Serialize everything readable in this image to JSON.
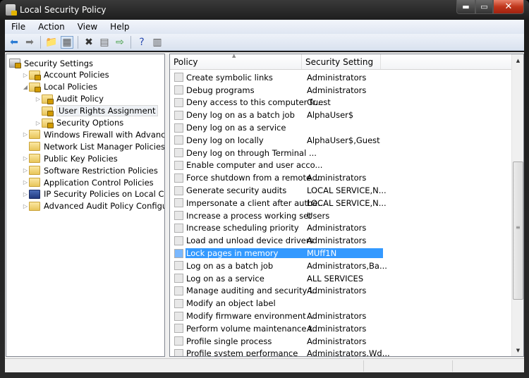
{
  "window": {
    "title": "Local Security Policy",
    "controls": [
      "minimize",
      "maximize",
      "close"
    ]
  },
  "menu": [
    "File",
    "Action",
    "View",
    "Help"
  ],
  "toolbar": [
    {
      "icon": "back-arrow-icon",
      "glyph": "⬅",
      "color": "#2a7bd4"
    },
    {
      "icon": "forward-arrow-icon",
      "glyph": "➡",
      "color": "#7a7a7a"
    },
    {
      "icon": "up-folder-icon",
      "glyph": "📁",
      "color": "#d8a520"
    },
    {
      "icon": "show-hide-tree-icon",
      "glyph": "▦",
      "color": "#555"
    },
    {
      "icon": "delete-icon",
      "glyph": "✖",
      "color": "#333"
    },
    {
      "icon": "properties-icon",
      "glyph": "▤",
      "color": "#666"
    },
    {
      "icon": "export-list-icon",
      "glyph": "⇨",
      "color": "#3a9a3a"
    },
    {
      "icon": "help-icon",
      "glyph": "?",
      "color": "#2a4ab0"
    },
    {
      "icon": "action-pane-icon",
      "glyph": "▥",
      "color": "#555"
    }
  ],
  "tree": [
    {
      "label": "Security Settings",
      "level": 0,
      "expander": "",
      "icon": "security-settings-icon"
    },
    {
      "label": "Account Policies",
      "level": 1,
      "expander": "▷",
      "icon": "lock-folder-icon"
    },
    {
      "label": "Local Policies",
      "level": 1,
      "expander": "◢",
      "icon": "lock-folder-icon"
    },
    {
      "label": "Audit Policy",
      "level": 2,
      "expander": "▷",
      "icon": "lock-folder-icon"
    },
    {
      "label": "User Rights Assignment",
      "level": 2,
      "expander": "",
      "icon": "lock-folder-icon",
      "selected": true
    },
    {
      "label": "Security Options",
      "level": 2,
      "expander": "▷",
      "icon": "lock-folder-icon"
    },
    {
      "label": "Windows Firewall with Advanced Security",
      "level": 1,
      "expander": "▷",
      "icon": "folder-icon"
    },
    {
      "label": "Network List Manager Policies",
      "level": 1,
      "expander": "",
      "icon": "folder-icon"
    },
    {
      "label": "Public Key Policies",
      "level": 1,
      "expander": "▷",
      "icon": "folder-icon"
    },
    {
      "label": "Software Restriction Policies",
      "level": 1,
      "expander": "▷",
      "icon": "folder-icon"
    },
    {
      "label": "Application Control Policies",
      "level": 1,
      "expander": "▷",
      "icon": "folder-icon"
    },
    {
      "label": "IP Security Policies on Local Computer",
      "level": 1,
      "expander": "▷",
      "icon": "network-policy-icon"
    },
    {
      "label": "Advanced Audit Policy Configuration",
      "level": 1,
      "expander": "▷",
      "icon": "folder-icon"
    }
  ],
  "list": {
    "columns": [
      "Policy",
      "Security Setting"
    ],
    "sort_column": "Policy",
    "rows": [
      {
        "policy": "Create symbolic links",
        "setting": "Administrators"
      },
      {
        "policy": "Debug programs",
        "setting": "Administrators"
      },
      {
        "policy": "Deny access to this computer fr...",
        "setting": "Guest"
      },
      {
        "policy": "Deny log on as a batch job",
        "setting": "AlphaUser$"
      },
      {
        "policy": "Deny log on as a service",
        "setting": ""
      },
      {
        "policy": "Deny log on locally",
        "setting": "AlphaUser$,Guest"
      },
      {
        "policy": "Deny log on through Terminal ...",
        "setting": ""
      },
      {
        "policy": "Enable computer and user acco...",
        "setting": ""
      },
      {
        "policy": "Force shutdown from a remote ...",
        "setting": "Administrators"
      },
      {
        "policy": "Generate security audits",
        "setting": "LOCAL SERVICE,N..."
      },
      {
        "policy": "Impersonate a client after authe...",
        "setting": "LOCAL SERVICE,N..."
      },
      {
        "policy": "Increase a process working set",
        "setting": "Users"
      },
      {
        "policy": "Increase scheduling priority",
        "setting": "Administrators"
      },
      {
        "policy": "Load and unload device drivers",
        "setting": "Administrators"
      },
      {
        "policy": "Lock pages in memory",
        "setting": "MUff1N",
        "selected": true
      },
      {
        "policy": "Log on as a batch job",
        "setting": "Administrators,Ba..."
      },
      {
        "policy": "Log on as a service",
        "setting": "ALL SERVICES"
      },
      {
        "policy": "Manage auditing and security l...",
        "setting": "Administrators"
      },
      {
        "policy": "Modify an object label",
        "setting": ""
      },
      {
        "policy": "Modify firmware environment ...",
        "setting": "Administrators"
      },
      {
        "policy": "Perform volume maintenance t...",
        "setting": "Administrators"
      },
      {
        "policy": "Profile single process",
        "setting": "Administrators"
      },
      {
        "policy": "Profile system performance",
        "setting": "Administrators,Wd..."
      }
    ]
  },
  "colors": {
    "selection": "#3399ff",
    "close_button": "#c0361c"
  }
}
